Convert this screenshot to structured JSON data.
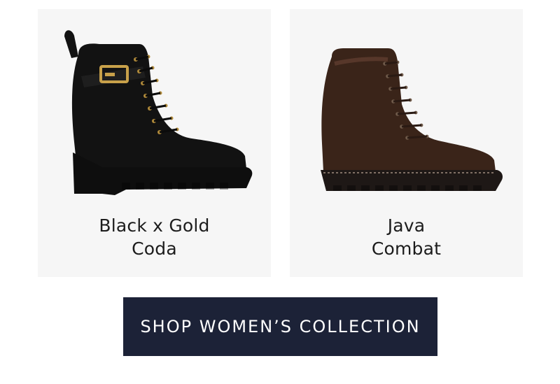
{
  "products": [
    {
      "name_line1": "Black x Gold",
      "name_line2": "Coda",
      "image_icon": "black-gold-coda-boot-image"
    },
    {
      "name_line1": "Java",
      "name_line2": "Combat",
      "image_icon": "java-combat-boot-image"
    }
  ],
  "cta": {
    "label": "SHOP WOMEN’S COLLECTION",
    "bg_color": "#1c2237",
    "text_color": "#ffffff"
  },
  "colors": {
    "card_bg": "#f6f6f6",
    "black_boot": "#121212",
    "brown_boot": "#3a2419",
    "gold_accent": "#c8a14a"
  }
}
